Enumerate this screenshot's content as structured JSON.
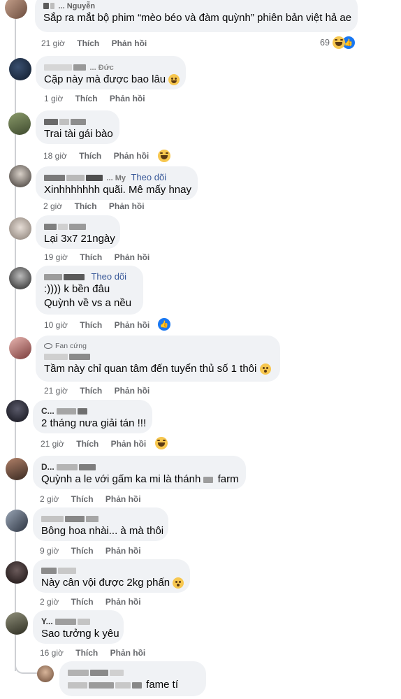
{
  "comments": [
    {
      "name": "... Nguyễn",
      "text": "Sắp ra mắt bộ phim “mèo béo và đàm quỳnh” phiên bản việt hả ae",
      "time": "21 giờ",
      "reaction_count": "69"
    },
    {
      "name": "... Đức",
      "text": "Cặp này mà được bao lâu",
      "time": "1 giờ"
    },
    {
      "name": "",
      "text": "Trai tài gái bào",
      "time": "18 giờ"
    },
    {
      "name": "... My",
      "follow": "Theo dõi",
      "text": "Xinhhhhhhh quãi. Mê mấy hnay",
      "time": "2 giờ"
    },
    {
      "name": "",
      "text": "Lại 3x7 21ngày",
      "time": "19 giờ"
    },
    {
      "name": "",
      "follow": "Theo dõi",
      "text1": ":)))) k bền đâu",
      "text2": "Quỳnh về vs a nều",
      "time": "10 giờ"
    },
    {
      "badge": "Fan cứng",
      "text": "Tầm này chỉ quan tâm đến tuyển thủ số 1 thôi",
      "time": "21 giờ"
    },
    {
      "name": "C...",
      "text": "2 tháng nưa giải tán !!!",
      "time": "21 giờ"
    },
    {
      "name": "D...",
      "text": "Quỳnh a le với gấm ka mi là thánh",
      "text_tail": "farm",
      "time": "2 giờ"
    },
    {
      "name": "",
      "text": "Bông hoa nhài... à mà thôi",
      "time": "9 giờ"
    },
    {
      "name": "",
      "text": "Này cân vội được 2kg phấn",
      "time": "2 giờ"
    },
    {
      "name": "Y...",
      "text": "Sao tưởng k yêu",
      "time": "16 giờ"
    },
    {
      "name": "",
      "text": "fame tí",
      "time": ""
    }
  ],
  "actions": {
    "like": "Thích",
    "reply": "Phản hồi"
  },
  "colors": {
    "bubble": "#f0f2f5",
    "link": "#385898",
    "meta": "#65676b",
    "like": "#1877f2"
  },
  "icons": [
    "laugh-emoji-icon",
    "like-icon",
    "eye-icon",
    "grin-emoji-icon",
    "surprised-emoji-icon"
  ]
}
